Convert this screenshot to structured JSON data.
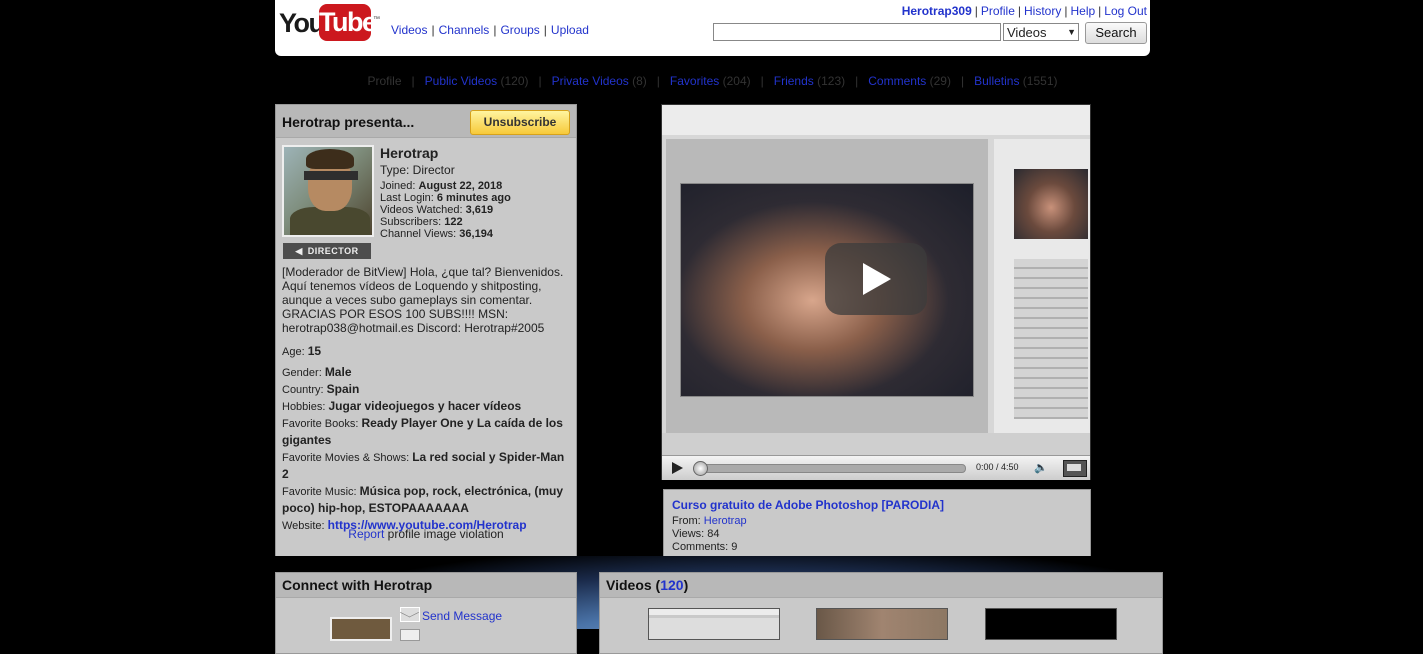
{
  "header": {
    "logo": {
      "you": "You",
      "tube": "Tube",
      "tm": "™"
    },
    "nav": [
      "Videos",
      "Channels",
      "Groups",
      "Upload"
    ],
    "user_links": {
      "username": "Herotrap309",
      "links": [
        "Profile",
        "History",
        "Help",
        "Log Out"
      ]
    },
    "search": {
      "value": "",
      "category": "Videos",
      "button": "Search"
    }
  },
  "tabs": [
    {
      "label": "Profile",
      "count": ""
    },
    {
      "label": "Public Videos",
      "count": "(120)"
    },
    {
      "label": "Private Videos",
      "count": "(8)"
    },
    {
      "label": "Favorites",
      "count": "(204)"
    },
    {
      "label": "Friends",
      "count": "(123)"
    },
    {
      "label": "Comments",
      "count": "(29)"
    },
    {
      "label": "Bulletins",
      "count": "(1551)"
    }
  ],
  "profile": {
    "panel_title": "Herotrap presenta...",
    "unsubscribe": "Unsubscribe",
    "badge": "DIRECTOR",
    "name": "Herotrap",
    "type": "Type: Director",
    "stats": [
      {
        "label": "Joined: ",
        "value": "August 22, 2018"
      },
      {
        "label": "Last Login: ",
        "value": "6 minutes ago"
      },
      {
        "label": "Videos Watched: ",
        "value": "3,619"
      },
      {
        "label": "Subscribers: ",
        "value": "122"
      },
      {
        "label": "Channel Views: ",
        "value": "36,194"
      }
    ],
    "description": "[Moderador de BitView] Hola, ¿que tal? Bienvenidos. Aquí tenemos vídeos de Loquendo y shitposting, aunque a veces subo gameplays sin comentar. GRACIAS POR ESOS 100 SUBS!!!! MSN: herotrap038@hotmail.es Discord: Herotrap#2005",
    "details": [
      {
        "label": "Age: ",
        "value": "15"
      },
      {
        "label": "Gender: ",
        "value": "Male"
      },
      {
        "label": "Country: ",
        "value": "Spain"
      },
      {
        "label": "Hobbies: ",
        "value": "Jugar videojuegos y hacer vídeos"
      },
      {
        "label": "Favorite Books: ",
        "value": "Ready Player One y La caída de los gigantes"
      },
      {
        "label": "Favorite Movies & Shows: ",
        "value": "La red social y Spider-Man 2"
      },
      {
        "label": "Favorite Music: ",
        "value": "Música pop, rock, electrónica, (muy poco) hip-hop, ESTOPAAAAAAA"
      }
    ],
    "website_label": "Website: ",
    "website": "https://www.youtube.com/Herotrap",
    "report_link": "Report",
    "report_text": " profile image violation"
  },
  "player": {
    "time": "0:00 / 4:50",
    "progress": 0
  },
  "featured_video": {
    "title": "Curso gratuito de Adobe Photoshop [PARODIA]",
    "from_label": "From: ",
    "from": "Herotrap",
    "views": "Views: 84",
    "comments": "Comments: 9"
  },
  "connect": {
    "title": "Connect with Herotrap",
    "send_message": "Send Message"
  },
  "videos": {
    "title": "Videos",
    "count": "120"
  },
  "colors": {
    "link": "#2233cc",
    "panel": "#c9c9c9",
    "unsubscribe": "#f7c93a"
  }
}
